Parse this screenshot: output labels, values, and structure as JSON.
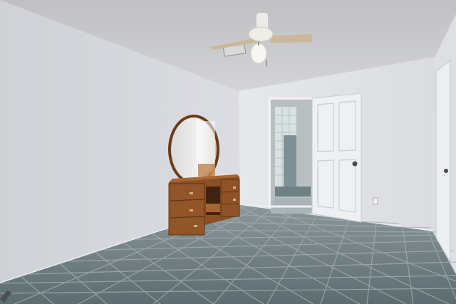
{
  "scene": {
    "description_tags": [
      "bedroom",
      "ceiling-fan",
      "vanity-mirror",
      "tile-floor",
      "open-door",
      "bathroom"
    ],
    "colors": {
      "ceiling": "#c9cacc",
      "wall_left": "#d6d7dc",
      "wall_back": "#e4e6ea",
      "wall_right": "#dcdde2",
      "floor": "#6c7b80",
      "grout": "#9aa4a7",
      "wood": "#8a4f22",
      "wood_dark": "#5e3416",
      "door": "#eef0f2",
      "fan": "#e9e7e2",
      "fan_blade": "#c8b69a"
    }
  }
}
